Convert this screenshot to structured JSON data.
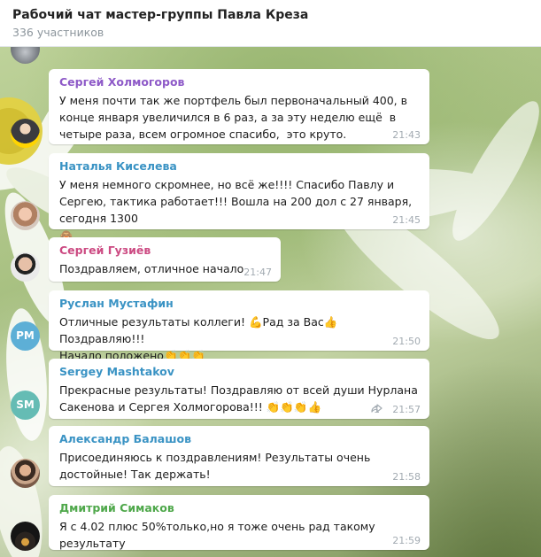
{
  "header": {
    "title": "Рабочий чат мастер-группы Павла Креза",
    "subtitle": "336 участников"
  },
  "messages": [
    {
      "author": "Сергей Холмогоров",
      "author_color": "#8e5ac8",
      "text": "У меня почти так же портфель был первоначальный 400, в конце января увеличился в 6 раз, а за эту неделю ещё  в четыре раза, всем огромное спасибо,  это круто.",
      "time": "21:43"
    },
    {
      "author": "Наталья Киселева",
      "author_color": "#3a93c4",
      "text": "У меня немного скромнее, но всё же!!!! Спасибо Павлу и Сергею, тактика работает!!! Вошла на 200 дол с 27 января, сегодня 1300",
      "emoji_after": "🙈",
      "time": "21:45"
    },
    {
      "author": "Сергей Гузиёв",
      "author_color": "#cc4a82",
      "text": "Поздравляем, отличное начало",
      "time": "21:47"
    },
    {
      "author": "Руслан Мустафин",
      "author_color": "#3a93c4",
      "avatar_initials": "РМ",
      "avatar_color": "#5dafd6",
      "text_parts": [
        "Отличные результаты коллеги! ",
        "💪",
        "Рад за Вас",
        "👍",
        " Поздравляю!!!",
        "Начало положено",
        "👏👏👏"
      ],
      "time": "21:50"
    },
    {
      "author": "Sergey Mashtakov",
      "author_color": "#3a93c4",
      "avatar_initials": "SM",
      "avatar_color": "#65bcb4",
      "text": "Прекрасные результаты! Поздравляю от всей души Нурлана Сакенова и Сергея Холмогорова!!!",
      "emoji_after": "👏👏👏👍",
      "forward_count": "1",
      "time": "21:57"
    },
    {
      "author": "Александр Балашов",
      "author_color": "#3a93c4",
      "text": "Присоединяюсь к поздравлениям! Результаты очень достойные! Так держать!",
      "time": "21:58"
    },
    {
      "author": "Дмитрий Симаков",
      "author_color": "#4fa84b",
      "text": "Я с 4.02 плюс 50%только,но я тоже очень рад такому результату",
      "time": "21:59"
    }
  ],
  "icons": {
    "forward": "forward-arrow-icon"
  }
}
